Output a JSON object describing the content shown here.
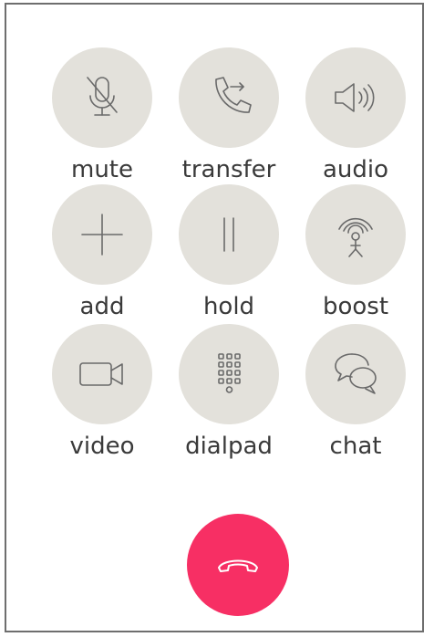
{
  "buttons": {
    "mute": {
      "label": "mute",
      "icon": "microphone-muted-icon"
    },
    "transfer": {
      "label": "transfer",
      "icon": "phone-transfer-icon"
    },
    "audio": {
      "label": "audio",
      "icon": "speaker-icon"
    },
    "add": {
      "label": "add",
      "icon": "plus-icon"
    },
    "hold": {
      "label": "hold",
      "icon": "pause-icon"
    },
    "boost": {
      "label": "boost",
      "icon": "signal-boost-icon"
    },
    "video": {
      "label": "video",
      "icon": "video-camera-icon"
    },
    "dialpad": {
      "label": "dialpad",
      "icon": "dialpad-icon"
    },
    "chat": {
      "label": "chat",
      "icon": "chat-bubbles-icon"
    }
  },
  "end_call": {
    "icon": "hang-up-icon"
  },
  "colors": {
    "button_bg": "#e3e1db",
    "icon": "#6a6a6a",
    "label": "#3a3a3a",
    "end_call_bg": "#f72f64",
    "frame_border": "#6e6e6e"
  }
}
